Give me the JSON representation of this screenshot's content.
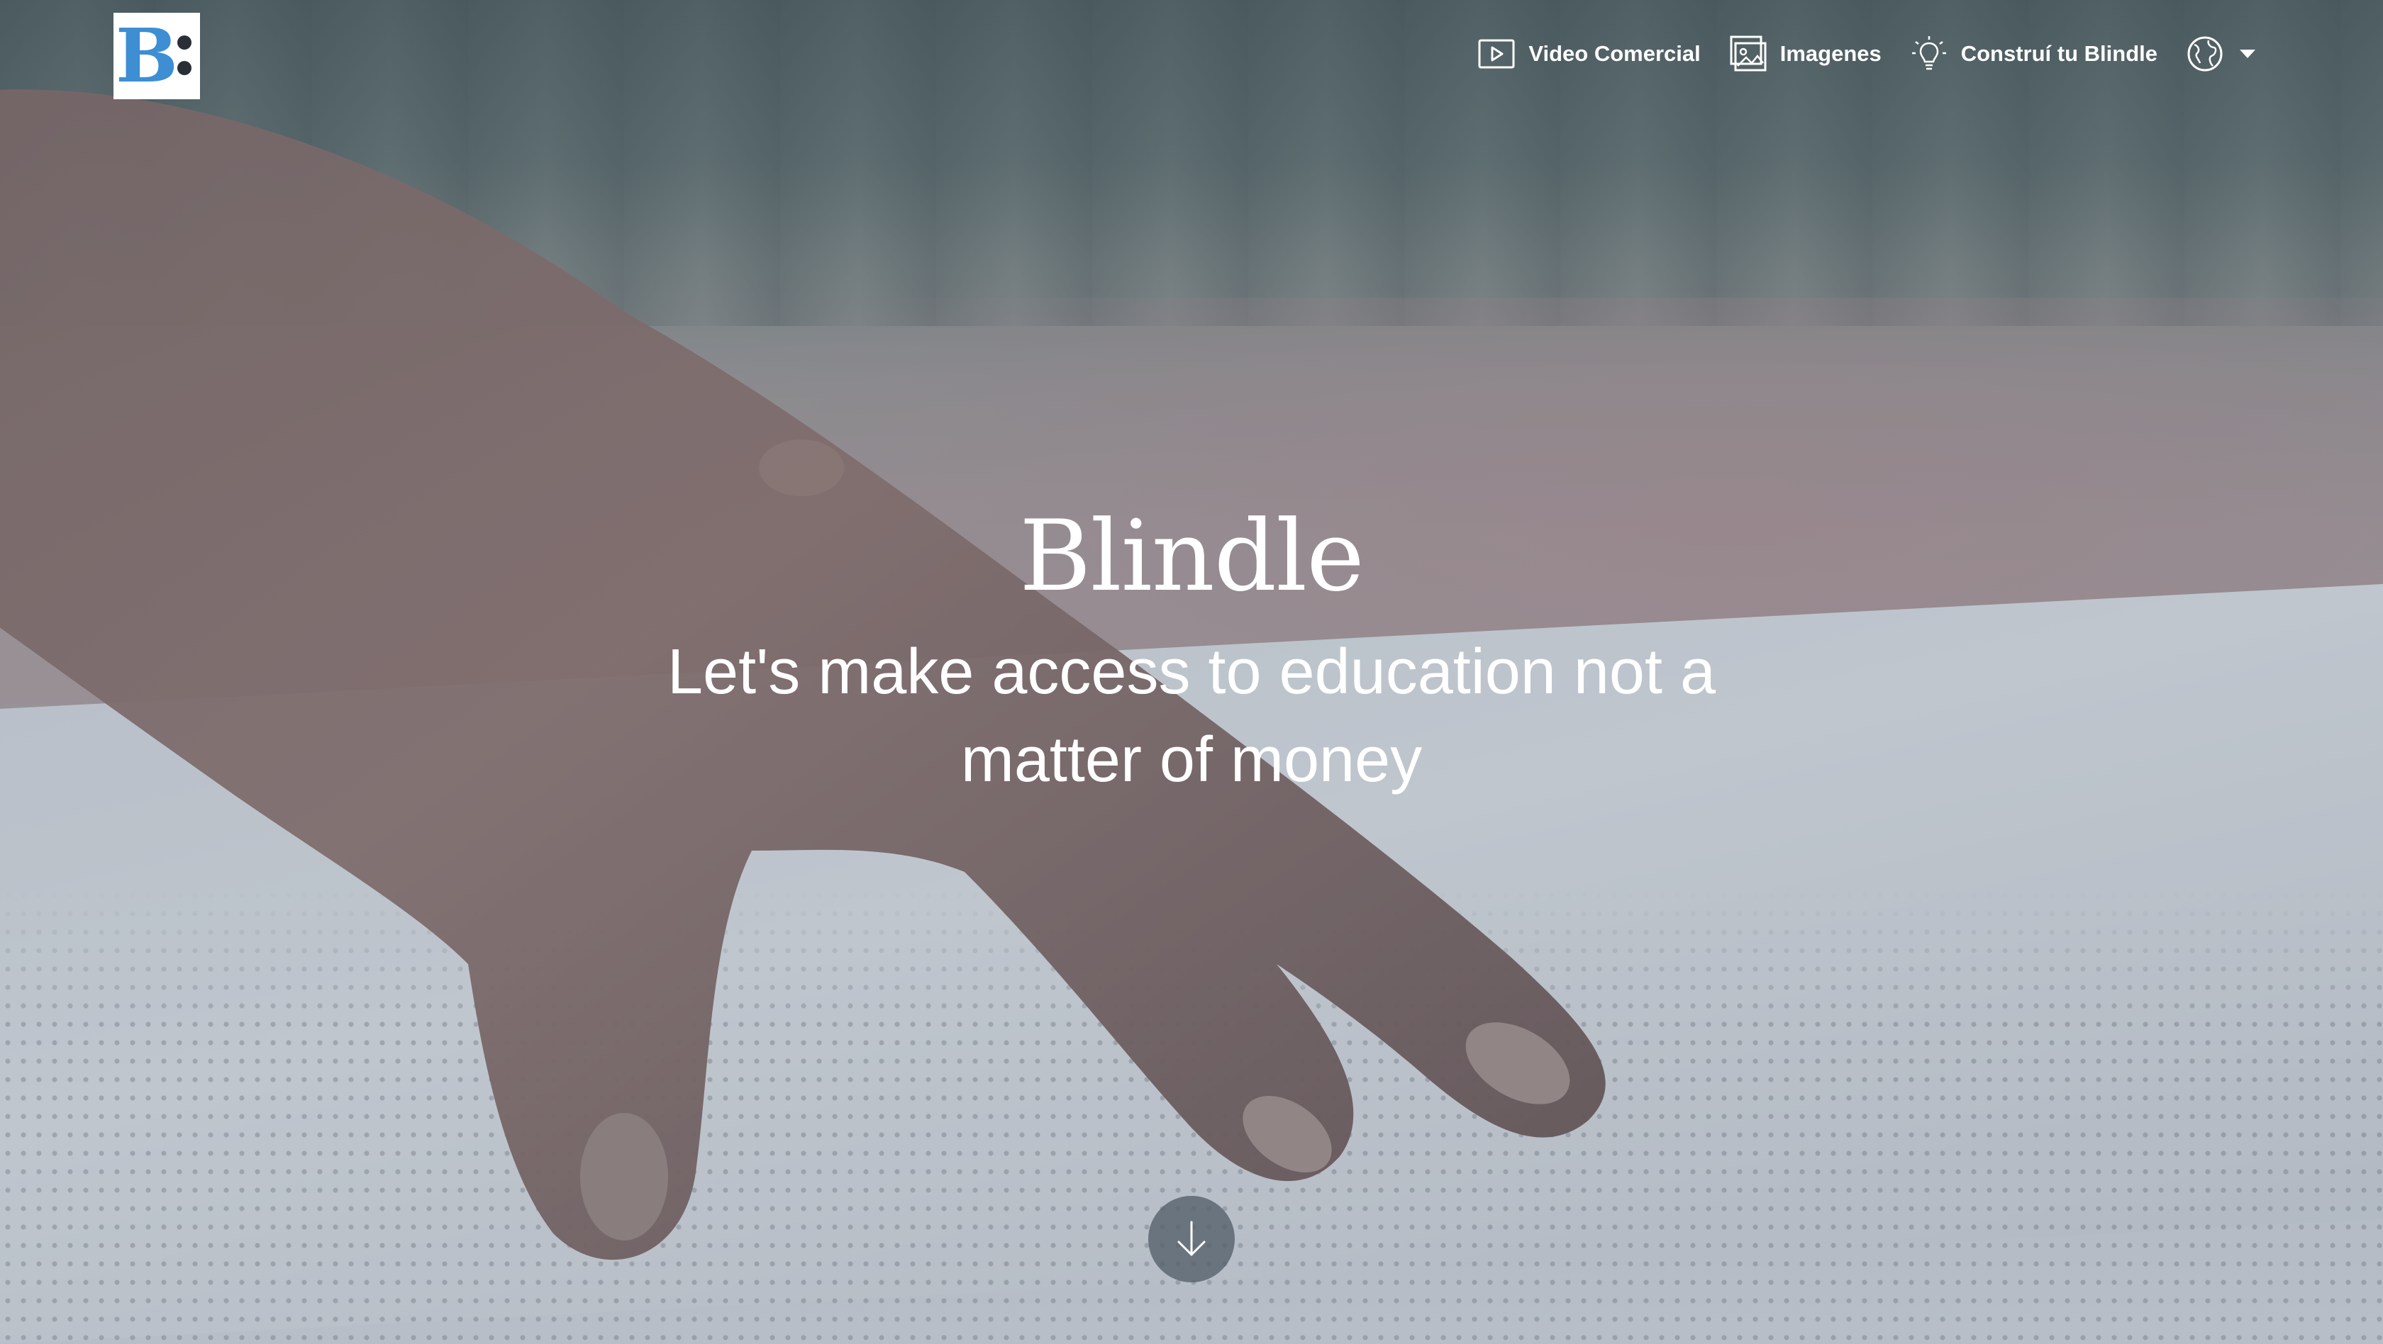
{
  "brand": {
    "name": "Blindle",
    "logo_letter": "B",
    "logo_color": "#3d8ed3"
  },
  "nav": {
    "items": [
      {
        "label": "Video Comercial",
        "icon": "play-video-icon"
      },
      {
        "label": "Imagenes",
        "icon": "image-gallery-icon"
      },
      {
        "label": "Construí tu Blindle",
        "icon": "lightbulb-icon"
      }
    ],
    "language": {
      "icon": "globe-icon",
      "dropdown": "caret-down-icon"
    }
  },
  "hero": {
    "title": "Blindle",
    "subtitle": "Let's make access to education not a matter of money"
  },
  "scroll_button": {
    "icon": "arrow-down-icon"
  },
  "colors": {
    "text": "#ffffff",
    "overlay": "#3c5064"
  }
}
